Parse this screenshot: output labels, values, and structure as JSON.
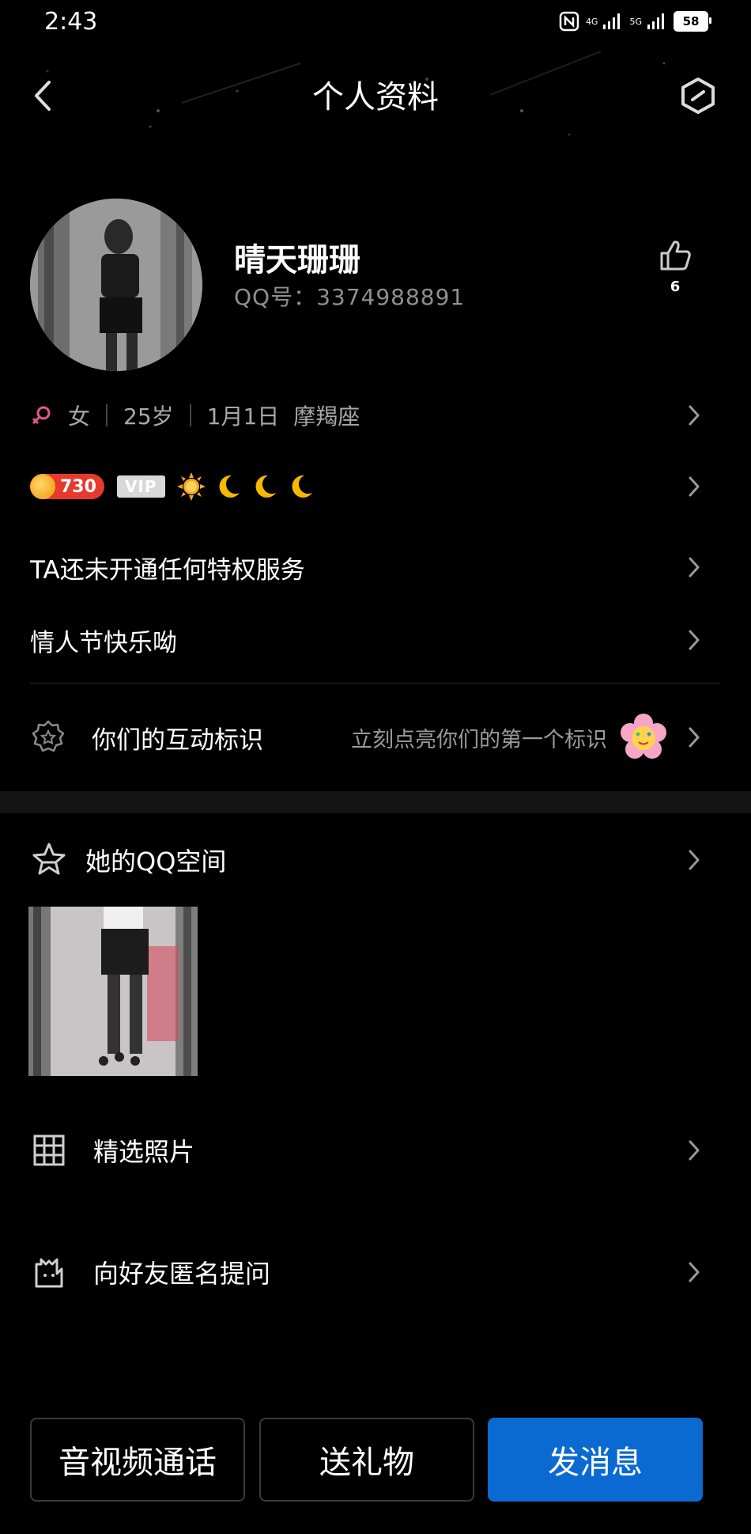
{
  "status_bar": {
    "time": "2:43",
    "network_1": "4G",
    "network_2": "5G",
    "battery": "58"
  },
  "header": {
    "title": "个人资料"
  },
  "profile": {
    "nickname": "晴天珊珊",
    "qq_number": "QQ号：3374988891",
    "likes": "6",
    "gender": "女",
    "age": "25岁",
    "birthday": "1月1日",
    "zodiac": "摩羯座"
  },
  "badges": {
    "level": "730",
    "vip": "VIP"
  },
  "rows": {
    "privilege": "TA还未开通任何特权服务",
    "signature": "情人节快乐呦"
  },
  "interaction": {
    "label": "你们的互动标识",
    "hint": "立刻点亮你们的第一个标识"
  },
  "qzone": {
    "label": "她的QQ空间"
  },
  "featured_photos": {
    "label": "精选照片"
  },
  "anonymous_question": {
    "label": "向好友匿名提问"
  },
  "actions": {
    "call": "音视频通话",
    "gift": "送礼物",
    "message": "发消息"
  },
  "colors": {
    "background": "#000000",
    "primary_button": "#0a6ad2",
    "level_badge": "#e8392e",
    "muted_text": "#8f8f8f"
  }
}
